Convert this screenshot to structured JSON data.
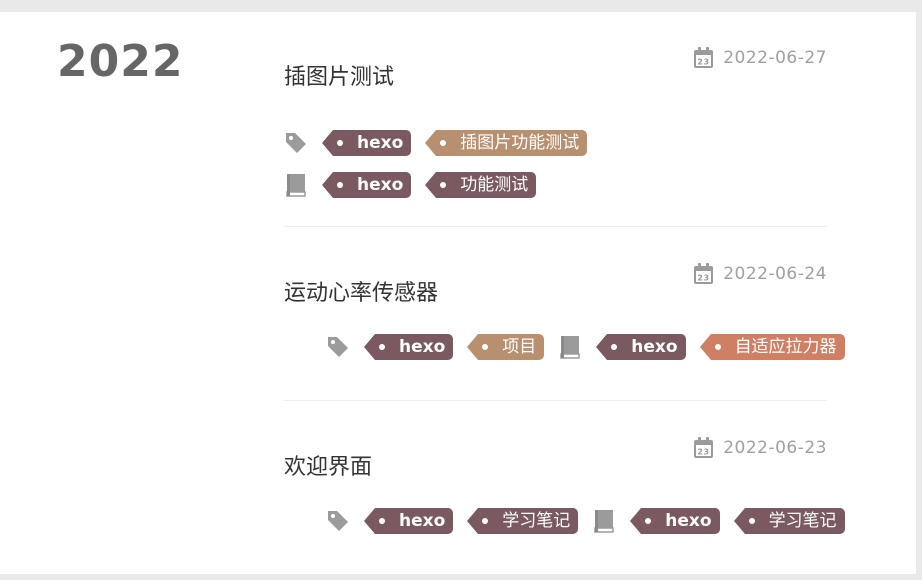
{
  "archive": {
    "year": "2022"
  },
  "colors": {
    "tag_dark": "#7a5a60",
    "tag_tan": "#b89070",
    "tag_orange": "#cf7f63",
    "icon_gray": "#9b9b9b"
  },
  "posts": [
    {
      "title": "插图片测试",
      "date": "2022-06-27",
      "tags": [
        "hexo",
        "插图片功能测试"
      ],
      "categories": [
        "hexo",
        "功能测试"
      ]
    },
    {
      "title": "运动心率传感器",
      "date": "2022-06-24",
      "tags": [
        "hexo",
        "项目"
      ],
      "categories": [
        "hexo",
        "自适应拉力器"
      ]
    },
    {
      "title": "欢迎界面",
      "date": "2022-06-23",
      "tags": [
        "hexo",
        "学习笔记"
      ],
      "categories": [
        "hexo",
        "学习笔记"
      ]
    }
  ]
}
